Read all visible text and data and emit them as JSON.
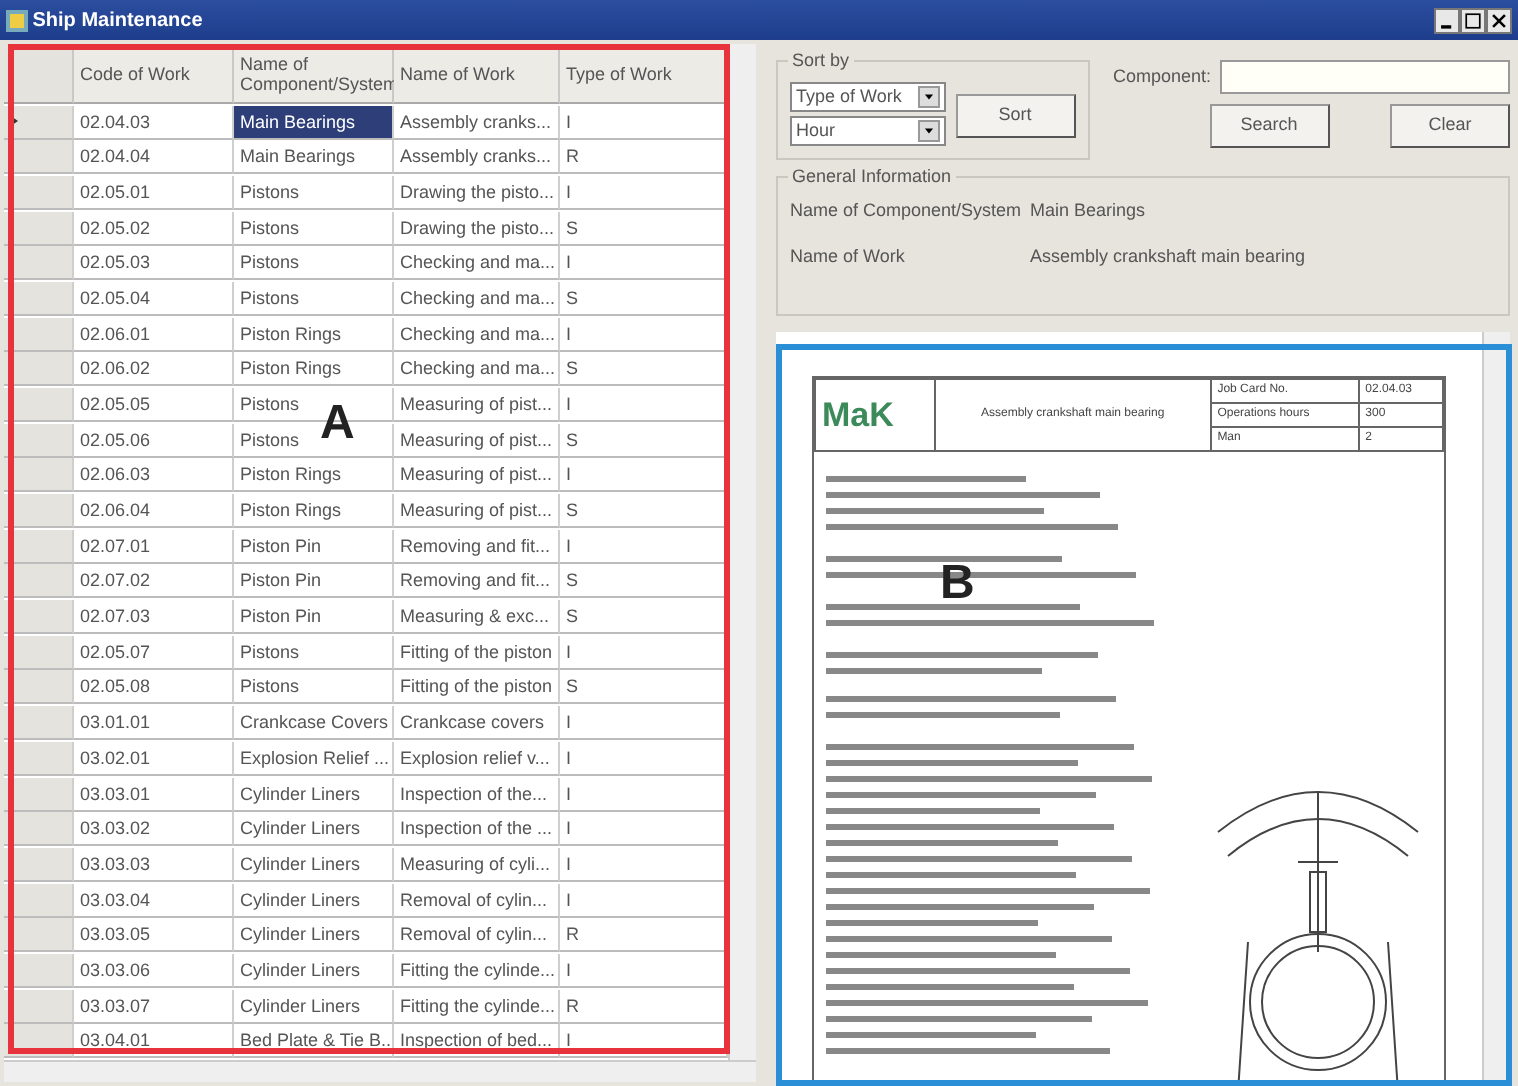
{
  "window": {
    "title": "Ship Maintenance"
  },
  "table": {
    "columns": [
      "Code of Work",
      "Name of Component/System",
      "Name of Work",
      "Type of Work"
    ],
    "rows": [
      {
        "selected": true,
        "cells": [
          "02.04.03",
          "Main Bearings",
          "Assembly cranks...",
          "I"
        ]
      },
      {
        "selected": false,
        "cells": [
          "02.04.04",
          "Main Bearings",
          "Assembly cranks...",
          "R"
        ]
      },
      {
        "selected": false,
        "cells": [
          "02.05.01",
          "Pistons",
          "Drawing the pisto...",
          "I"
        ]
      },
      {
        "selected": false,
        "cells": [
          "02.05.02",
          "Pistons",
          "Drawing the pisto...",
          "S"
        ]
      },
      {
        "selected": false,
        "cells": [
          "02.05.03",
          "Pistons",
          "Checking and ma...",
          "I"
        ]
      },
      {
        "selected": false,
        "cells": [
          "02.05.04",
          "Pistons",
          "Checking and ma...",
          "S"
        ]
      },
      {
        "selected": false,
        "cells": [
          "02.06.01",
          "Piston Rings",
          "Checking and ma...",
          "I"
        ]
      },
      {
        "selected": false,
        "cells": [
          "02.06.02",
          "Piston Rings",
          "Checking and ma...",
          "S"
        ]
      },
      {
        "selected": false,
        "cells": [
          "02.05.05",
          "Pistons",
          "Measuring of pist...",
          "I"
        ]
      },
      {
        "selected": false,
        "cells": [
          "02.05.06",
          "Pistons",
          "Measuring of pist...",
          "S"
        ]
      },
      {
        "selected": false,
        "cells": [
          "02.06.03",
          "Piston Rings",
          "Measuring of pist...",
          "I"
        ]
      },
      {
        "selected": false,
        "cells": [
          "02.06.04",
          "Piston Rings",
          "Measuring of pist...",
          "S"
        ]
      },
      {
        "selected": false,
        "cells": [
          "02.07.01",
          "Piston Pin",
          "Removing and fit...",
          "I"
        ]
      },
      {
        "selected": false,
        "cells": [
          "02.07.02",
          "Piston Pin",
          "Removing and fit...",
          "S"
        ]
      },
      {
        "selected": false,
        "cells": [
          "02.07.03",
          "Piston Pin",
          "Measuring & exc...",
          "S"
        ]
      },
      {
        "selected": false,
        "cells": [
          "02.05.07",
          "Pistons",
          "Fitting of the piston",
          "I"
        ]
      },
      {
        "selected": false,
        "cells": [
          "02.05.08",
          "Pistons",
          "Fitting of the piston",
          "S"
        ]
      },
      {
        "selected": false,
        "cells": [
          "03.01.01",
          "Crankcase Covers",
          "Crankcase covers",
          "I"
        ]
      },
      {
        "selected": false,
        "cells": [
          "03.02.01",
          "Explosion Relief ...",
          "Explosion relief v...",
          "I"
        ]
      },
      {
        "selected": false,
        "cells": [
          "03.03.01",
          "Cylinder Liners",
          "Inspection of the...",
          "I"
        ]
      },
      {
        "selected": false,
        "cells": [
          "03.03.02",
          "Cylinder Liners",
          "Inspection of the ...",
          "I"
        ]
      },
      {
        "selected": false,
        "cells": [
          "03.03.03",
          "Cylinder Liners",
          "Measuring of cyli...",
          "I"
        ]
      },
      {
        "selected": false,
        "cells": [
          "03.03.04",
          "Cylinder Liners",
          "Removal of cylin...",
          "I"
        ]
      },
      {
        "selected": false,
        "cells": [
          "03.03.05",
          "Cylinder Liners",
          "Removal of cylin...",
          "R"
        ]
      },
      {
        "selected": false,
        "cells": [
          "03.03.06",
          "Cylinder Liners",
          "Fitting the cylinde...",
          "I"
        ]
      },
      {
        "selected": false,
        "cells": [
          "03.03.07",
          "Cylinder Liners",
          "Fitting the cylinde...",
          "R"
        ]
      },
      {
        "selected": false,
        "cells": [
          "03.04.01",
          "Bed Plate & Tie B...",
          "Inspection of bed...",
          "I"
        ]
      }
    ]
  },
  "sort_panel": {
    "title": "Sort by",
    "fields": [
      {
        "value": "Type of Work"
      },
      {
        "value": "Hour"
      }
    ],
    "button": "Sort"
  },
  "search": {
    "label": "Component:",
    "buttons": [
      "Search",
      "Clear"
    ]
  },
  "general_info": {
    "title": "General Information",
    "fields": [
      {
        "label": "Name of Component/System",
        "value": "Main Bearings"
      },
      {
        "label": "Name of Work",
        "value": "Assembly crankshaft main bearing"
      }
    ]
  },
  "document": {
    "logo": "MaK",
    "title": "Assembly crankshaft main bearing",
    "info": [
      {
        "label": "Job Card No.",
        "value": "02.04.03"
      },
      {
        "label": "Operations hours",
        "value": "300"
      },
      {
        "label": "Man",
        "value": "2"
      }
    ]
  },
  "annotations": [
    {
      "label": "A",
      "color": "#e8323c"
    },
    {
      "label": "B",
      "color": "#2a8fd6"
    }
  ]
}
